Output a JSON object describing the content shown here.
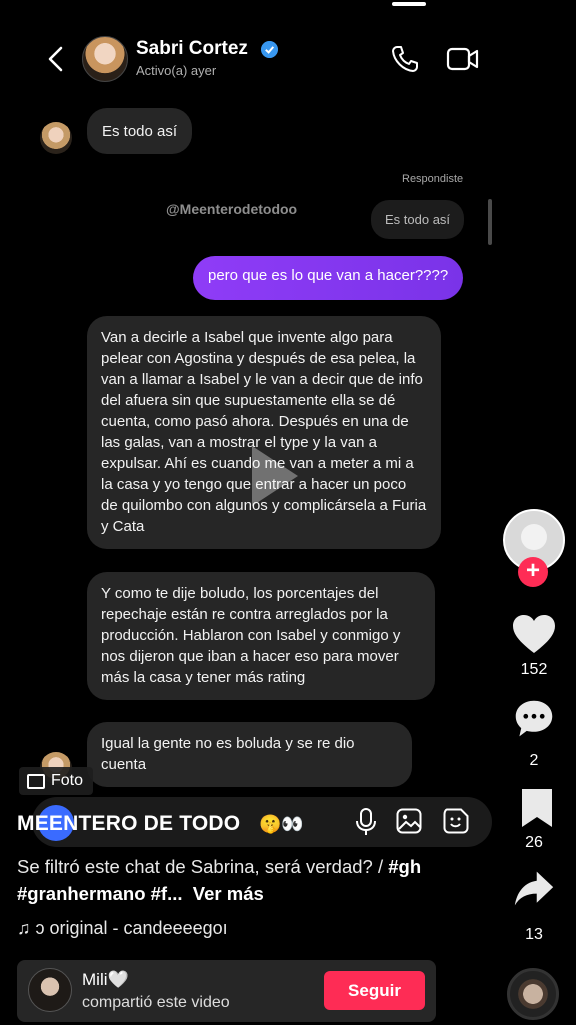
{
  "header": {
    "contact_name": "Sabri Cortez",
    "status": "Activo(a) ayer"
  },
  "messages": {
    "m1": "Es todo así",
    "replied_label": "Respondiste",
    "watermark": "@Meenterodetodoo",
    "reply_quote": "Es todo así",
    "outgoing": "pero que es lo que van a hacer????",
    "m2": "Van a decirle a Isabel que invente algo para pelear con Agostina y después de esa pelea, la van a llamar a Isabel y le van a decir que de info del afuera sin que supuestamente ella se dé cuenta, como pasó ahora. Después en una de las galas, van a mostrar el type y la van a expulsar. Ahí es cuando me van a meter a mi a la casa y yo tengo que entrar a hacer un poco de quilombo con algunos y complicársela a Furia y Cata",
    "m3": "Y como te dije boludo, los porcentajes del repechaje están re contra arreglados por la producción. Hablaron con Isabel y conmigo y nos dijeron que iban a hacer eso para mover más la casa y tener más rating",
    "m4": "Igual la gente no es boluda y se re dio cuenta"
  },
  "photo_tag": "Foto",
  "caption": {
    "title": "MEENTERO DE TODO",
    "emoji": "🤫👀",
    "text": "Se filtró este chat de Sabrina, será verdad? / ",
    "tags": "#gh #granhermano #f...",
    "more": "Ver más",
    "sound": "♫ ɔ original - candeeeegoı"
  },
  "rail": {
    "likes": "152",
    "comments": "2",
    "saves": "26",
    "shares": "13"
  },
  "share_banner": {
    "name": "Mili🤍",
    "subtitle": "compartió este video",
    "follow_label": "Seguir"
  },
  "colors": {
    "outgoing_bubble": "#8f3cf7",
    "incoming_bubble": "#262626",
    "follow": "#fe2c55",
    "verified": "#3897f0"
  }
}
